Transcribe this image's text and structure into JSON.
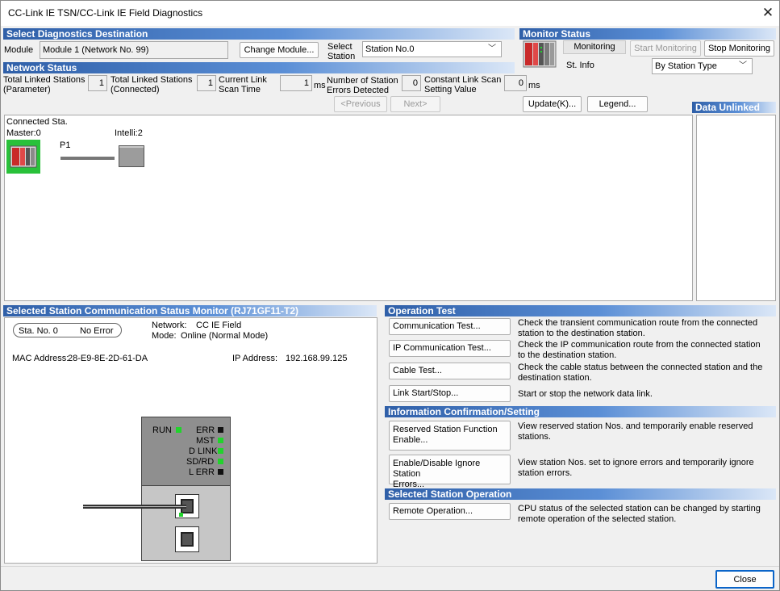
{
  "window": {
    "title": "CC-Link IE TSN/CC-Link IE Field Diagnostics"
  },
  "select_destination": {
    "header": "Select Diagnostics Destination",
    "module_label": "Module",
    "module_value": "Module 1 (Network No. 99)",
    "change_module_button": "Change Module...",
    "select_station_label": [
      "Select",
      "Station"
    ],
    "station_value": "Station No.0"
  },
  "monitor_status": {
    "header": "Monitor Status",
    "state": "Monitoring",
    "start_button": "Start Monitoring",
    "stop_button": "Stop Monitoring",
    "st_info_label": "St. Info",
    "st_info_value": "By Station Type"
  },
  "network_status": {
    "header": "Network Status",
    "items": [
      {
        "label": [
          "Total Linked Stations",
          "(Parameter)"
        ],
        "value": "1",
        "unit": ""
      },
      {
        "label": [
          "Total Linked Stations",
          "(Connected)"
        ],
        "value": "1",
        "unit": ""
      },
      {
        "label": [
          "Current Link",
          "Scan Time"
        ],
        "value": "1",
        "unit": "ms"
      },
      {
        "label": [
          "Number of Station",
          "Errors Detected"
        ],
        "value": "0",
        "unit": ""
      },
      {
        "label": [
          "Constant Link Scan",
          "Setting Value"
        ],
        "value": "0",
        "unit": "ms"
      }
    ],
    "previous_button": "<Previous",
    "next_button": "Next>",
    "update_button": "Update(K)...",
    "legend_button": "Legend..."
  },
  "topology": {
    "connected_label": "Connected Sta.",
    "master_label": "Master:0",
    "port_label": "P1",
    "slave_label": "Intelli:2"
  },
  "data_unlinked": {
    "header": "Data Unlinked"
  },
  "comm_status": {
    "header": "Selected Station Communication Status Monitor (RJ71GF11-T2)",
    "station_no": "Sta. No. 0",
    "error_status": "No Error",
    "network_label": "Network:",
    "network_value": "CC IE Field",
    "mode_label": "Mode:",
    "mode_value": "Online (Normal Mode)",
    "mac_label": "MAC Address:",
    "mac_value": "28-E9-8E-2D-61-DA",
    "ip_label": "IP Address:",
    "ip_value": "192.168.99.125",
    "leds": {
      "run": "RUN",
      "err": "ERR",
      "mst": "MST",
      "dlink": "D LINK",
      "sdrd": "SD/RD",
      "lerr": "L ERR"
    }
  },
  "operation_test": {
    "header": "Operation Test",
    "items": [
      {
        "button": "Communication Test...",
        "desc": [
          "Check the transient communication route from the connected",
          "station to the destination station."
        ]
      },
      {
        "button": "IP Communication Test...",
        "desc": [
          "Check the IP communication route from the connected station",
          "to the destination station."
        ]
      },
      {
        "button": "Cable Test...",
        "desc": [
          "Check the cable status between the connected station and the",
          "destination station."
        ]
      },
      {
        "button": "Link Start/Stop...",
        "desc": [
          "Start or stop the network data link.",
          ""
        ]
      }
    ]
  },
  "info_confirmation": {
    "header": "Information Confirmation/Setting",
    "items": [
      {
        "button": [
          "Reserved Station Function",
          "Enable..."
        ],
        "desc": [
          "View reserved station Nos. and temporarily enable reserved",
          "stations."
        ]
      },
      {
        "button": [
          "Enable/Disable Ignore Station",
          "Errors..."
        ],
        "desc": [
          "View station Nos. set to ignore errors and temporarily ignore",
          "station errors."
        ]
      }
    ]
  },
  "station_operation": {
    "header": "Selected Station Operation",
    "button": "Remote Operation...",
    "desc": [
      "CPU status of the selected station can be changed by starting",
      "remote operation of the selected station."
    ]
  },
  "footer": {
    "close_button": "Close"
  },
  "colors": {
    "header_blue": "#2f5fa8",
    "led_green": "#21d32c",
    "master_highlight": "#29c13a"
  }
}
